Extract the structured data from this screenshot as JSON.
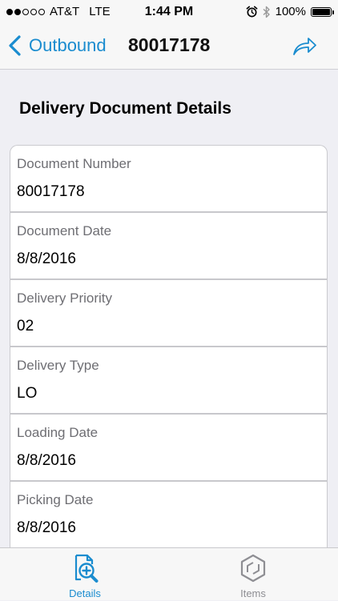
{
  "status_bar": {
    "carrier": "AT&T",
    "network": "LTE",
    "time": "1:44 PM",
    "battery": "100%",
    "battery_level": 1.0,
    "signal_bars_filled": 2,
    "signal_bars_total": 5,
    "icons": [
      "alarm-icon",
      "bluetooth-icon",
      "battery-icon"
    ]
  },
  "nav": {
    "back_label": "Outbound",
    "title": "80017178",
    "share_icon": "share-arrow-icon"
  },
  "section_title": "Delivery Document Details",
  "fields": [
    {
      "label": "Document Number",
      "value": "80017178"
    },
    {
      "label": "Document Date",
      "value": "8/8/2016"
    },
    {
      "label": "Delivery Priority",
      "value": "02"
    },
    {
      "label": "Delivery Type",
      "value": "LO"
    },
    {
      "label": "Loading Date",
      "value": "8/8/2016"
    },
    {
      "label": "Picking Date",
      "value": "8/8/2016"
    }
  ],
  "tabs": [
    {
      "label": "Details",
      "icon": "document-search-icon",
      "selected": true
    },
    {
      "label": "Items",
      "icon": "cube-icon",
      "selected": false
    }
  ],
  "colors": {
    "accent": "#1a8ccf",
    "background": "#efeff4",
    "inactive_tab": "#8e8e93",
    "field_label": "#6e6e73"
  }
}
